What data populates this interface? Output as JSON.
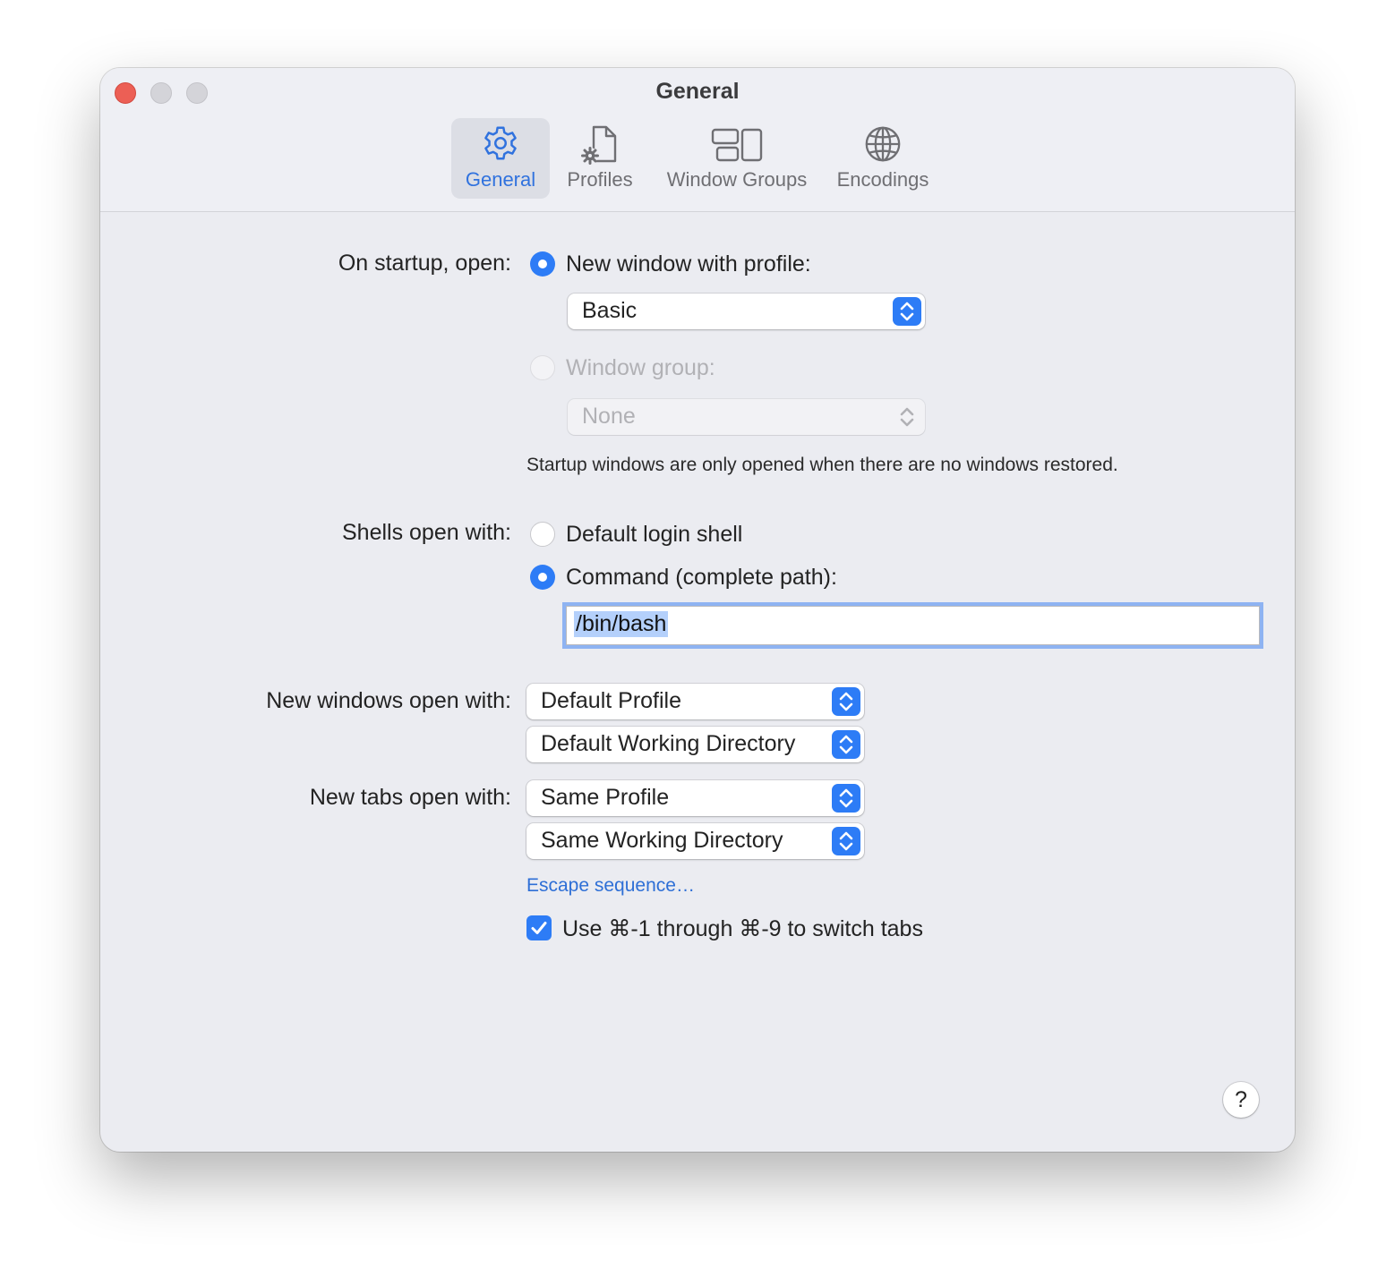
{
  "window": {
    "title": "General",
    "toolbar_tabs": [
      {
        "label": "General",
        "icon": "gear-icon",
        "active": true
      },
      {
        "label": "Profiles",
        "icon": "profile-document-icon",
        "active": false
      },
      {
        "label": "Window Groups",
        "icon": "window-groups-icon",
        "active": false
      },
      {
        "label": "Encodings",
        "icon": "globe-icon",
        "active": false
      }
    ]
  },
  "startup": {
    "label": "On startup, open:",
    "new_window_option": "New window with profile:",
    "new_window_selected": true,
    "profile_select": "Basic",
    "window_group_option": "Window group:",
    "window_group_select": "None",
    "note": "Startup windows are only opened when there are no windows restored."
  },
  "shells": {
    "label": "Shells open with:",
    "default_option": "Default login shell",
    "command_option": "Command (complete path):",
    "command_selected": true,
    "command_value": "/bin/bash"
  },
  "new_windows": {
    "label": "New windows open with:",
    "profile_select": "Default Profile",
    "directory_select": "Default Working Directory"
  },
  "new_tabs": {
    "label": "New tabs open with:",
    "profile_select": "Same Profile",
    "directory_select": "Same Working Directory"
  },
  "escape_link": "Escape sequence…",
  "switch_tabs": {
    "label": "Use ⌘-1 through ⌘-9 to switch tabs",
    "checked": true
  },
  "help_label": "?",
  "colors": {
    "accent": "#2d7cf6",
    "link": "#2e6fd6",
    "close": "#ec5f55",
    "window_bg": "#ebecf1"
  }
}
